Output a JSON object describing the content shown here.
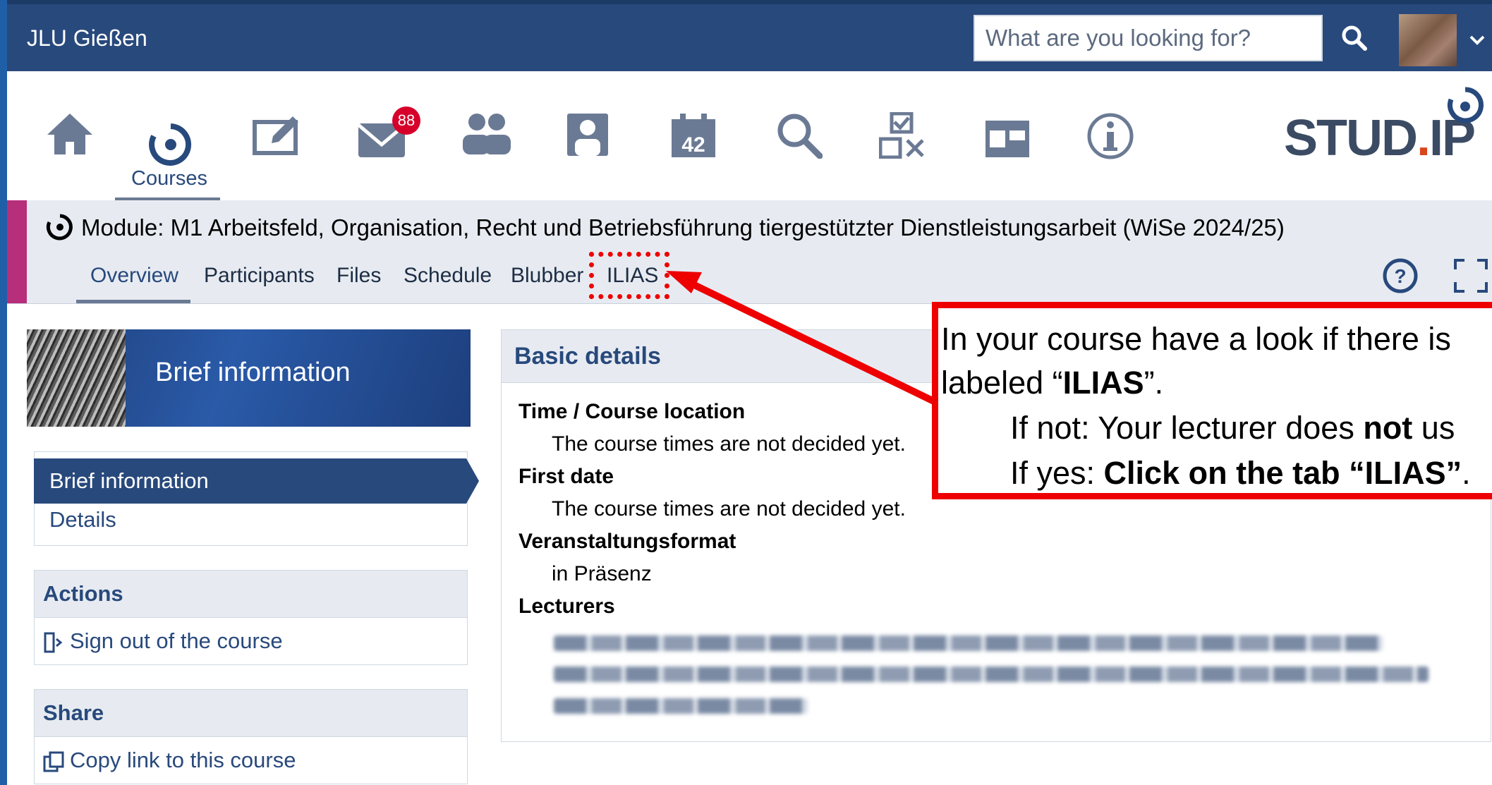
{
  "header": {
    "org_name": "JLU Gießen",
    "search_placeholder": "What are you looking for?"
  },
  "nav": {
    "items": [
      "home-icon",
      "courses-icon",
      "content-icon",
      "messages-icon",
      "community-icon",
      "profile-icon",
      "planner-icon",
      "search-icon",
      "tools-icon",
      "browse-icon",
      "info-icon"
    ],
    "active_label": "Courses",
    "message_badge": "88",
    "logo_text_main": "STUD",
    "logo_text_dot": ".",
    "logo_text_end": "IP"
  },
  "course": {
    "title": "Module: M1 Arbeitsfeld, Organisation, Recht und Betriebsführung tiergestützter Dienstleistungsarbeit (WiSe 2024/25)",
    "tabs": [
      "Overview",
      "Participants",
      "Files",
      "Schedule",
      "Blubber",
      "ILIAS"
    ],
    "active_tab": "Overview"
  },
  "sidebar": {
    "banner_title": "Brief information",
    "nav_items": [
      "Brief information",
      "Details"
    ],
    "actions_title": "Actions",
    "actions_items": [
      "Sign out of the course"
    ],
    "share_title": "Share",
    "share_items": [
      "Copy link to this course"
    ]
  },
  "basic_details": {
    "title": "Basic details",
    "fields": [
      {
        "label": "Time / Course location",
        "value": "The course times are not decided yet."
      },
      {
        "label": "First date",
        "value": "The course times are not decided yet."
      },
      {
        "label": "Veranstaltungsformat",
        "value": "in Präsenz"
      },
      {
        "label": "Lecturers",
        "value": ""
      }
    ]
  },
  "annotation": {
    "line1": "In your course have a look if there is",
    "line2_pre": "labeled “",
    "line2_bold": "ILIAS",
    "line2_post": "”.",
    "line3_pre": "If not: Your lecturer does ",
    "line3_bold": "not",
    "line3_post": " us",
    "line4_pre": "If yes: ",
    "line4_bold": "Click on the tab “ILIAS”",
    "line4_post": ".",
    "color": "#ee0000"
  },
  "colors": {
    "brand": "#28497c",
    "accent_bar": "#b72e7b",
    "badge": "#d6002a"
  }
}
